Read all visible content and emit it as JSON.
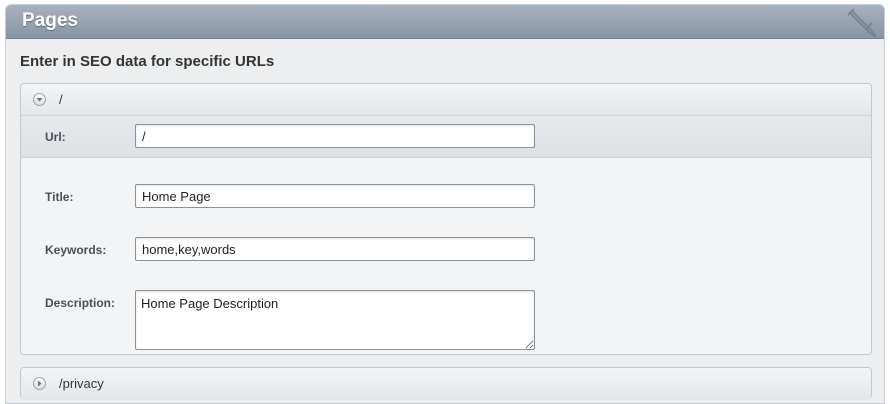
{
  "header": {
    "title": "Pages"
  },
  "subheading": "Enter in SEO data for specific URLs",
  "pages": [
    {
      "label": "/",
      "expanded": true,
      "fields": {
        "url": {
          "label": "Url:",
          "value": "/"
        },
        "title": {
          "label": "Title:",
          "value": "Home Page"
        },
        "keywords": {
          "label": "Keywords:",
          "value": "home,key,words"
        },
        "description": {
          "label": "Description:",
          "value": "Home Page Description"
        }
      }
    },
    {
      "label": "/privacy",
      "expanded": false
    }
  ],
  "icons": {
    "header_icon": "pencil-icon",
    "expanded_toggle": "chevron-down-icon",
    "collapsed_toggle": "chevron-right-icon"
  },
  "colors": {
    "header_bg": "#8f9caa",
    "panel_bg": "#eceeef",
    "url_row_bg": "#e1e4e8"
  }
}
